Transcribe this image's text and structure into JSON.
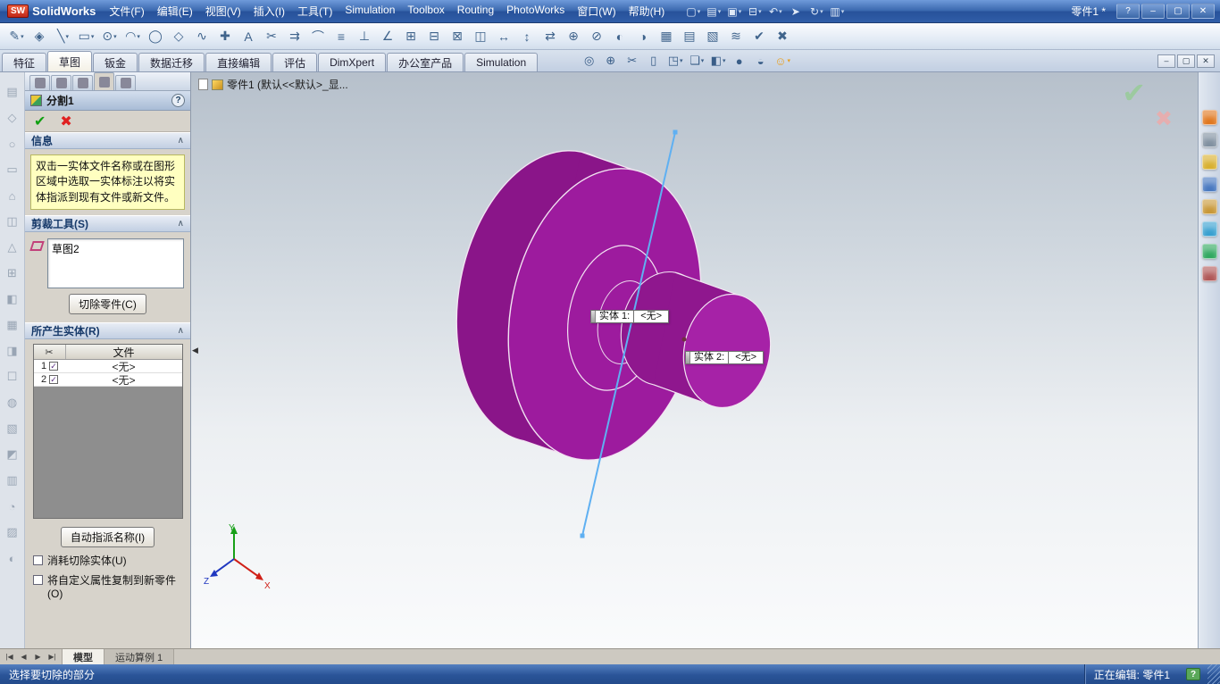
{
  "titlebar": {
    "app": "SolidWorks",
    "doc": "零件1 *"
  },
  "menus": [
    "文件(F)",
    "编辑(E)",
    "视图(V)",
    "插入(I)",
    "工具(T)",
    "Simulation",
    "Toolbox",
    "Routing",
    "PhotoWorks",
    "窗口(W)",
    "帮助(H)"
  ],
  "window_controls": [
    {
      "glyph": "?",
      "name": "help-button"
    },
    {
      "glyph": "‒",
      "name": "minimize-button"
    },
    {
      "glyph": "▢",
      "name": "maximize-button"
    },
    {
      "glyph": "✕",
      "name": "close-button"
    }
  ],
  "quick_icons": [
    {
      "glyph": "▢",
      "caret": "▾",
      "name": "new-document-icon"
    },
    {
      "glyph": "▤",
      "caret": "▾",
      "name": "open-document-icon"
    },
    {
      "glyph": "▣",
      "caret": "▾",
      "name": "save-icon"
    },
    {
      "glyph": "⊟",
      "caret": "▾",
      "name": "print-icon"
    },
    {
      "glyph": "↶",
      "caret": "▾",
      "name": "undo-icon"
    },
    {
      "glyph": "➤",
      "caret": "",
      "name": "select-icon"
    },
    {
      "glyph": "↻",
      "caret": "▾",
      "name": "rebuild-icon"
    },
    {
      "glyph": "▥",
      "caret": "▾",
      "name": "options-icon"
    }
  ],
  "toolbar2": [
    {
      "glyph": "✎",
      "caret": "▾",
      "name": "sketch-icon"
    },
    {
      "glyph": "◈",
      "caret": "",
      "name": "smart-dimension-icon"
    },
    {
      "glyph": "╲",
      "caret": "▾",
      "name": "line-icon"
    },
    {
      "glyph": "▭",
      "caret": "▾",
      "name": "rectangle-icon"
    },
    {
      "glyph": "⊙",
      "caret": "▾",
      "name": "circle-icon"
    },
    {
      "glyph": "◠",
      "caret": "▾",
      "name": "arc-icon"
    },
    {
      "glyph": "◯",
      "caret": "",
      "name": "ellipse-icon"
    },
    {
      "glyph": "◇",
      "caret": "",
      "name": "polygon-icon"
    },
    {
      "glyph": "∿",
      "caret": "",
      "name": "spline-icon"
    },
    {
      "glyph": "✚",
      "caret": "",
      "name": "point-icon"
    },
    {
      "glyph": "A",
      "caret": "",
      "name": "text-icon"
    },
    {
      "glyph": "✂",
      "caret": "",
      "name": "trim-entities-icon"
    },
    {
      "glyph": "⇉",
      "caret": "",
      "name": "offset-entities-icon"
    },
    {
      "glyph": "⌒",
      "caret": "",
      "name": "tangent-arc-icon"
    },
    {
      "glyph": "≡",
      "caret": "",
      "name": "centerline-icon"
    },
    {
      "glyph": "⊥",
      "caret": "",
      "name": "perpendicular-relation-icon"
    },
    {
      "glyph": "∠",
      "caret": "",
      "name": "angle-dimension-icon"
    },
    {
      "glyph": "⊞",
      "caret": "",
      "name": "linear-pattern-icon"
    },
    {
      "glyph": "⊟",
      "caret": "",
      "name": "circular-pattern-icon"
    },
    {
      "glyph": "⊠",
      "caret": "",
      "name": "convert-entities-icon"
    },
    {
      "glyph": "◫",
      "caret": "",
      "name": "mirror-entities-icon"
    },
    {
      "glyph": "↔",
      "caret": "",
      "name": "move-entities-icon"
    },
    {
      "glyph": "↕",
      "caret": "",
      "name": "stretch-entities-icon"
    },
    {
      "glyph": "⇄",
      "caret": "",
      "name": "replace-entities-icon"
    },
    {
      "glyph": "⊕",
      "caret": "",
      "name": "add-relation-icon"
    },
    {
      "glyph": "⊘",
      "caret": "",
      "name": "display-relations-icon"
    },
    {
      "glyph": "◐",
      "caret": "",
      "name": "shaded-contours-icon"
    },
    {
      "glyph": "◑",
      "caret": "",
      "name": "quick-snaps-icon"
    },
    {
      "glyph": "▦",
      "caret": "",
      "name": "grid-icon"
    },
    {
      "glyph": "▤",
      "caret": "",
      "name": "construction-geometry-icon"
    },
    {
      "glyph": "▧",
      "caret": "",
      "name": "hatch-icon"
    },
    {
      "glyph": "≋",
      "caret": "",
      "name": "spline-tools-icon"
    },
    {
      "glyph": "✔",
      "caret": "",
      "name": "ok-icon"
    },
    {
      "glyph": "✖",
      "caret": "",
      "name": "cancel-icon"
    }
  ],
  "tabs": [
    {
      "label": "特征",
      "active": false
    },
    {
      "label": "草图",
      "active": true
    },
    {
      "label": "钣金",
      "active": false
    },
    {
      "label": "数据迁移",
      "active": false
    },
    {
      "label": "直接编辑",
      "active": false
    },
    {
      "label": "评估",
      "active": false
    },
    {
      "label": "DimXpert",
      "active": false
    },
    {
      "label": "办公室产品",
      "active": false
    },
    {
      "label": "Simulation",
      "active": false
    }
  ],
  "view_tools": [
    {
      "glyph": "◎",
      "caret": "",
      "name": "zoom-fit-icon"
    },
    {
      "glyph": "⊕",
      "caret": "",
      "name": "zoom-area-icon"
    },
    {
      "glyph": "✂",
      "caret": "",
      "name": "section-view-icon"
    },
    {
      "glyph": "▯",
      "caret": "",
      "name": "previous-view-icon"
    },
    {
      "glyph": "◳",
      "caret": "▾",
      "name": "display-style-icon"
    },
    {
      "glyph": "❏",
      "caret": "▾",
      "name": "view-orientation-icon"
    },
    {
      "glyph": "◧",
      "caret": "▾",
      "name": "view-settings-icon"
    },
    {
      "glyph": "●",
      "caret": "",
      "name": "appearance-icon"
    },
    {
      "glyph": "◒",
      "caret": "",
      "name": "scene-icon"
    },
    {
      "glyph": "☺",
      "caret": "▾",
      "name": "realview-icon"
    }
  ],
  "doc_controls": [
    {
      "glyph": "‒",
      "name": "doc-minimize-button"
    },
    {
      "glyph": "▢",
      "name": "doc-restore-button"
    },
    {
      "glyph": "✕",
      "name": "doc-close-button"
    }
  ],
  "left_toolbar": [
    {
      "glyph": "▤",
      "name": "extrude-icon"
    },
    {
      "glyph": "◇",
      "name": "revolve-icon"
    },
    {
      "glyph": "○",
      "name": "sweep-icon"
    },
    {
      "glyph": "▭",
      "name": "loft-icon"
    },
    {
      "glyph": "⌂",
      "name": "rib-icon"
    },
    {
      "glyph": "◫",
      "name": "shell-icon"
    },
    {
      "glyph": "△",
      "name": "draft-icon"
    },
    {
      "glyph": "⊞",
      "name": "pattern-icon"
    },
    {
      "glyph": "◧",
      "name": "mirror-icon"
    },
    {
      "glyph": "▦",
      "name": "fillet-icon"
    },
    {
      "glyph": "◨",
      "name": "chamfer-icon"
    },
    {
      "glyph": "☐",
      "name": "hole-wizard-icon"
    },
    {
      "glyph": "◍",
      "name": "reference-geometry-icon"
    },
    {
      "glyph": "▧",
      "name": "curve-icon"
    },
    {
      "glyph": "◩",
      "name": "surface-icon"
    },
    {
      "glyph": "▥",
      "name": "sheet-metal-icon"
    },
    {
      "glyph": "◔",
      "name": "weldment-icon"
    },
    {
      "glyph": "▨",
      "name": "mold-tools-icon"
    },
    {
      "glyph": "◐",
      "name": "evaluate-icon"
    }
  ],
  "pm": {
    "tabs": [
      {
        "name": "featuremanager-tab-icon",
        "active": false
      },
      {
        "name": "propertymanager-tab-icon",
        "active": false
      },
      {
        "name": "configurationmanager-tab-icon",
        "active": false
      },
      {
        "name": "dimxpertmanager-tab-icon",
        "active": true
      },
      {
        "name": "displaymanager-tab-icon",
        "active": false
      }
    ],
    "title": "分割1",
    "help": "?",
    "ok": "✔",
    "cancel": "✖",
    "message": {
      "title": "信息",
      "chevron": "∧",
      "text": "双击一实体文件名称或在图形区域中选取一实体标注以将实体指派到现有文件或新文件。"
    },
    "trim": {
      "title": "剪裁工具(S)",
      "chevron": "∧",
      "selection": "草图2",
      "button": "切除零件(C)"
    },
    "result": {
      "title": "所产生实体(R)",
      "chevron": "∧",
      "col_tool": "✂",
      "col_file": "文件",
      "rows": [
        {
          "n": "1",
          "check": "✓",
          "file": "<无>"
        },
        {
          "n": "2",
          "check": "✓",
          "file": "<无>"
        }
      ],
      "auto_button": "自动指派名称(I)",
      "opt1": "消耗切除实体(U)",
      "opt2": "将自定义属性复制到新零件(O)"
    }
  },
  "viewport": {
    "breadcrumb": "零件1 (默认<<默认>_显...",
    "confirm_check": "✔",
    "confirm_cancel": "✖",
    "collapse_arrow": "◀",
    "callouts": [
      {
        "label": "实体  1:",
        "value": "<无>"
      },
      {
        "label": "实体  2:",
        "value": "<无>"
      }
    ],
    "triad": {
      "x": "X",
      "y": "Y",
      "z": "Z"
    }
  },
  "colors": {
    "part_front": "#9d1b9e",
    "part_side": "#8a1589",
    "boss_front": "#a622a7",
    "boss_side": "#8f178e",
    "edge": "#f2e4f2",
    "sketch_line": "#5fb0f2"
  },
  "taskpane": [
    {
      "name": "solidworks-resources-icon"
    },
    {
      "name": "design-library-icon"
    },
    {
      "name": "file-explorer-icon"
    },
    {
      "name": "search-icon"
    },
    {
      "name": "view-palette-icon"
    },
    {
      "name": "appearances-icon"
    },
    {
      "name": "scenes-icon"
    },
    {
      "name": "custom-properties-icon"
    }
  ],
  "bottom": {
    "nav": [
      "|◀",
      "◀",
      "▶",
      "▶|"
    ],
    "tabs": [
      {
        "label": "模型",
        "active": true
      },
      {
        "label": "运动算例 1",
        "active": false
      }
    ]
  },
  "statusbar": {
    "left": "选择要切除的部分",
    "editing": "正在编辑: 零件1",
    "help": "?"
  }
}
